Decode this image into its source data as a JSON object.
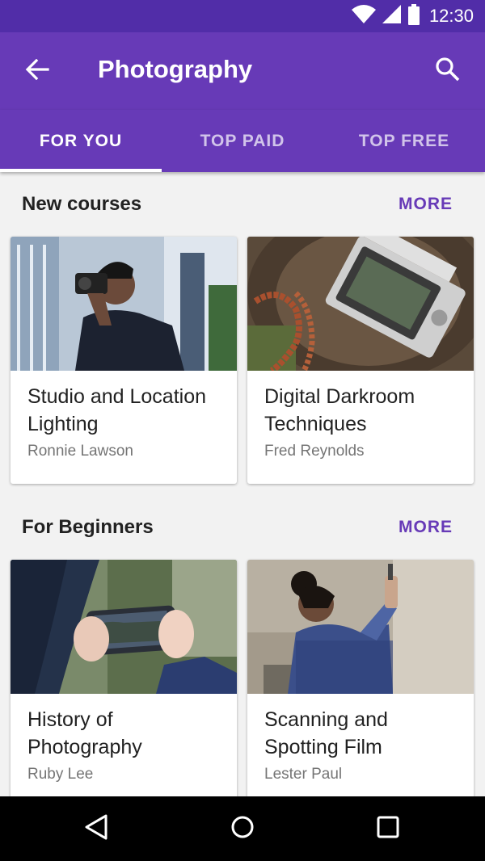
{
  "status_bar": {
    "time": "12:30",
    "icons": [
      "wifi-icon",
      "cellular-signal-icon",
      "battery-icon"
    ]
  },
  "app_bar": {
    "title": "Photography",
    "back_icon": "arrow-left-icon",
    "search_icon": "search-icon"
  },
  "tabs": [
    {
      "label": "FOR YOU",
      "active": true
    },
    {
      "label": "TOP PAID",
      "active": false
    },
    {
      "label": "TOP FREE",
      "active": false
    }
  ],
  "sections": [
    {
      "title": "New courses",
      "more_label": "MORE",
      "cards": [
        {
          "title": "Studio and Location Lighting",
          "author": "Ronnie Lawson"
        },
        {
          "title": "Digital Darkroom Techniques",
          "author": "Fred Reynolds"
        }
      ]
    },
    {
      "title": "For Beginners",
      "more_label": "MORE",
      "cards": [
        {
          "title": "History of Photography",
          "author": "Ruby Lee"
        },
        {
          "title": "Scanning and Spotting Film",
          "author": "Lester Paul"
        }
      ]
    }
  ],
  "nav_bar": {
    "icons": [
      "back-triangle-icon",
      "home-circle-icon",
      "recents-square-icon"
    ]
  },
  "colors": {
    "primary": "#673ab7",
    "primary_dark": "#512da8",
    "accent_text": "#673ab7"
  }
}
